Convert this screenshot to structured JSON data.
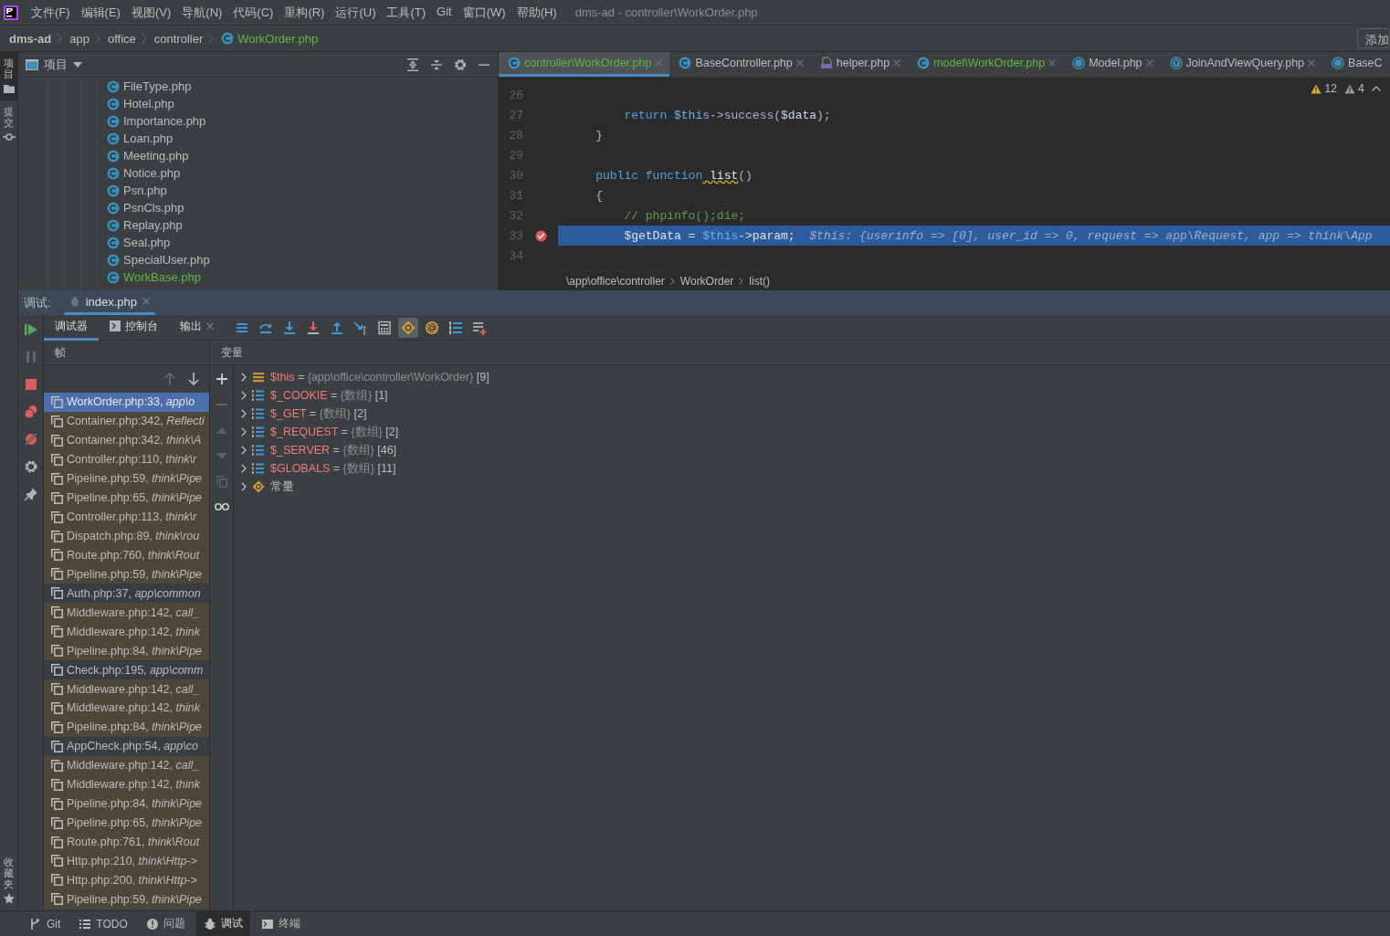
{
  "window": {
    "title": "dms-ad - controller\\WorkOrder.php"
  },
  "menu": [
    "文件(F)",
    "编辑(E)",
    "视图(V)",
    "导航(N)",
    "代码(C)",
    "重构(R)",
    "运行(U)",
    "工具(T)",
    "Git",
    "窗口(W)",
    "帮助(H)"
  ],
  "navbar": {
    "crumbs": [
      {
        "label": "dms-ad",
        "kind": "project"
      },
      {
        "label": "app",
        "kind": "dir"
      },
      {
        "label": "office",
        "kind": "dir"
      },
      {
        "label": "controller",
        "kind": "dir"
      },
      {
        "label": "WorkOrder.php",
        "kind": "file"
      }
    ],
    "button": "添加"
  },
  "side_strip": {
    "top": [
      {
        "label": "项目",
        "kind": "folder",
        "selected": true
      },
      {
        "label": "提交",
        "kind": "commit",
        "selected": false
      }
    ],
    "bottom": [
      {
        "label": "收藏夹",
        "kind": "star",
        "selected": false
      }
    ]
  },
  "project": {
    "title": "项目",
    "files": [
      {
        "name": "FileType.php",
        "modified": false
      },
      {
        "name": "Hotel.php",
        "modified": false
      },
      {
        "name": "Importance.php",
        "modified": false
      },
      {
        "name": "Loan.php",
        "modified": false
      },
      {
        "name": "Meeting.php",
        "modified": false
      },
      {
        "name": "Notice.php",
        "modified": false
      },
      {
        "name": "Psn.php",
        "modified": false
      },
      {
        "name": "PsnCls.php",
        "modified": false
      },
      {
        "name": "Replay.php",
        "modified": false
      },
      {
        "name": "Seal.php",
        "modified": false
      },
      {
        "name": "SpecialUser.php",
        "modified": false
      },
      {
        "name": "WorkBase.php",
        "modified": true
      }
    ]
  },
  "editor": {
    "tabs": [
      {
        "label": "controller\\WorkOrder.php",
        "kind": "class",
        "modified": true,
        "selected": true
      },
      {
        "label": "BaseController.php",
        "kind": "class",
        "modified": false,
        "selected": false
      },
      {
        "label": "helper.php",
        "kind": "php",
        "modified": false,
        "selected": false
      },
      {
        "label": "model\\WorkOrder.php",
        "kind": "class",
        "modified": true,
        "selected": false
      },
      {
        "label": "Model.php",
        "kind": "abstract",
        "modified": false,
        "selected": false
      },
      {
        "label": "JoinAndViewQuery.php",
        "kind": "trait",
        "modified": false,
        "selected": false
      },
      {
        "label": "BaseC",
        "kind": "abstract",
        "modified": false,
        "selected": false
      }
    ],
    "warnings": "12",
    "weak_warnings": "4",
    "lines": [
      {
        "number": "26",
        "breakpoint": false,
        "current": false
      },
      {
        "number": "27",
        "breakpoint": false,
        "current": false,
        "tokens": [
          {
            "kind": "keyword",
            "text": "        return"
          },
          {
            "kind": "this",
            "text": " $this"
          },
          {
            "kind": "plain",
            "text": "->success("
          },
          {
            "kind": "var",
            "text": "$data"
          },
          {
            "kind": "plain",
            "text": ");"
          }
        ]
      },
      {
        "number": "28",
        "breakpoint": false,
        "current": false,
        "tokens": [
          {
            "kind": "plain",
            "text": "    }"
          }
        ]
      },
      {
        "number": "29",
        "breakpoint": false,
        "current": false
      },
      {
        "number": "30",
        "breakpoint": false,
        "current": false,
        "tokens": [
          {
            "kind": "keyword",
            "text": "    public function"
          },
          {
            "kind": "warn",
            "text": " list"
          },
          {
            "kind": "plain",
            "text": "()"
          }
        ]
      },
      {
        "number": "31",
        "breakpoint": false,
        "current": false,
        "tokens": [
          {
            "kind": "plain",
            "text": "    {"
          }
        ]
      },
      {
        "number": "32",
        "breakpoint": false,
        "current": false,
        "tokens": [
          {
            "kind": "comment",
            "text": "        // phpinfo();die;"
          }
        ]
      },
      {
        "number": "33",
        "breakpoint": true,
        "current": true,
        "tokens": [
          {
            "kind": "plain",
            "text": "        $getData = "
          },
          {
            "kind": "this",
            "text": "$this"
          },
          {
            "kind": "plain",
            "text": "->param;"
          },
          {
            "kind": "hint",
            "text": "  $this: {userinfo => [0], user_id => 0, request => app\\Request, app => think\\App"
          }
        ]
      },
      {
        "number": "34",
        "breakpoint": false,
        "current": false
      }
    ],
    "breadcrumb": [
      "\\app\\office\\controller",
      "WorkOrder",
      "list()"
    ]
  },
  "debug": {
    "label": "调试:",
    "sessions": [
      {
        "label": "index.php",
        "selected": true
      }
    ],
    "side_tools": [
      {
        "kind": "resume",
        "disabled": false
      },
      {
        "kind": "pause",
        "disabled": true
      },
      {
        "kind": "stop",
        "disabled": false
      },
      {
        "kind": "breakpoints",
        "disabled": false
      },
      {
        "kind": "mute",
        "disabled": false
      },
      {
        "kind": "settings",
        "disabled": false
      },
      {
        "kind": "pin",
        "disabled": false
      }
    ],
    "tabs": [
      {
        "label": "调试器",
        "kind": "plain",
        "closable": false,
        "selected": true
      },
      {
        "label": "控制台",
        "kind": "console",
        "closable": false,
        "selected": false
      },
      {
        "label": "输出",
        "kind": "plain",
        "closable": true,
        "selected": false
      }
    ],
    "toolbar": [
      {
        "kind": "lines",
        "pressed": false
      },
      {
        "kind": "step-over",
        "pressed": false
      },
      {
        "kind": "step-into",
        "pressed": false
      },
      {
        "kind": "force-step-into",
        "pressed": false
      },
      {
        "kind": "step-out",
        "pressed": false
      },
      {
        "kind": "run-to-cursor",
        "pressed": false
      },
      {
        "kind": "evaluate",
        "pressed": false
      },
      {
        "kind": "constants",
        "pressed": true
      },
      {
        "kind": "at",
        "pressed": false
      },
      {
        "kind": "numbered",
        "pressed": false
      },
      {
        "kind": "add-list",
        "pressed": false
      }
    ],
    "frames_title": "帧",
    "frame_nav": [
      {
        "kind": "up",
        "disabled": true
      },
      {
        "kind": "down",
        "disabled": false
      }
    ],
    "frames": [
      {
        "label": "WorkOrder.php:33, *app\\o*",
        "library": false,
        "selected": true
      },
      {
        "label": "Container.php:342, *Reflecti*",
        "library": true,
        "selected": false
      },
      {
        "label": "Container.php:342, *think\\A*",
        "library": true,
        "selected": false
      },
      {
        "label": "Controller.php:110, *think\\r*",
        "library": true,
        "selected": false
      },
      {
        "label": "Pipeline.php:59, *think\\Pipe*",
        "library": true,
        "selected": false
      },
      {
        "label": "Pipeline.php:65, *think\\Pipe*",
        "library": true,
        "selected": false
      },
      {
        "label": "Controller.php:113, *think\\r*",
        "library": true,
        "selected": false
      },
      {
        "label": "Dispatch.php:89, *think\\rou*",
        "library": true,
        "selected": false
      },
      {
        "label": "Route.php:760, *think\\Rout*",
        "library": true,
        "selected": false
      },
      {
        "label": "Pipeline.php:59, *think\\Pipe*",
        "library": true,
        "selected": false
      },
      {
        "label": "Auth.php:37, *app\\common*",
        "library": false,
        "selected": false
      },
      {
        "label": "Middleware.php:142, *call_*",
        "library": true,
        "selected": false
      },
      {
        "label": "Middleware.php:142, *think*",
        "library": true,
        "selected": false
      },
      {
        "label": "Pipeline.php:84, *think\\Pipe*",
        "library": true,
        "selected": false
      },
      {
        "label": "Check.php:195, *app\\comm*",
        "library": false,
        "selected": false
      },
      {
        "label": "Middleware.php:142, *call_*",
        "library": true,
        "selected": false
      },
      {
        "label": "Middleware.php:142, *think*",
        "library": true,
        "selected": false
      },
      {
        "label": "Pipeline.php:84, *think\\Pipe*",
        "library": true,
        "selected": false
      },
      {
        "label": "AppCheck.php:54, *app\\co*",
        "library": false,
        "selected": false
      },
      {
        "label": "Middleware.php:142, *call_*",
        "library": true,
        "selected": false
      },
      {
        "label": "Middleware.php:142, *think*",
        "library": true,
        "selected": false
      },
      {
        "label": "Pipeline.php:84, *think\\Pipe*",
        "library": true,
        "selected": false
      },
      {
        "label": "Pipeline.php:65, *think\\Pipe*",
        "library": true,
        "selected": false
      },
      {
        "label": "Route.php:761, *think\\Rout*",
        "library": true,
        "selected": false
      },
      {
        "label": "Http.php:210, *think\\Http->*",
        "library": true,
        "selected": false
      },
      {
        "label": "Http.php:200, *think\\Http->*",
        "library": true,
        "selected": false
      },
      {
        "label": "Pipeline.php:59, *think\\Pipe*",
        "library": true,
        "selected": false
      }
    ],
    "variables_title": "变量",
    "var_tools": [
      {
        "kind": "add",
        "disabled": false
      },
      {
        "kind": "remove",
        "disabled": true
      },
      {
        "kind": "up",
        "disabled": true
      },
      {
        "kind": "down",
        "disabled": true
      },
      {
        "kind": "copy",
        "disabled": true
      },
      {
        "kind": "glasses",
        "disabled": false
      }
    ],
    "variables": [
      {
        "kind": "object",
        "name": "$this",
        "operator": "=",
        "value": "{app\\office\\controller\\WorkOrder}",
        "count": "[9]"
      },
      {
        "kind": "array",
        "name": "$_COOKIE",
        "operator": "=",
        "value": "{数组}",
        "count": "[1]"
      },
      {
        "kind": "array",
        "name": "$_GET",
        "operator": "=",
        "value": "{数组}",
        "count": "[2]"
      },
      {
        "kind": "array",
        "name": "$_REQUEST",
        "operator": "=",
        "value": "{数组}",
        "count": "[2]"
      },
      {
        "kind": "array",
        "name": "$_SERVER",
        "operator": "=",
        "value": "{数组}",
        "count": "[46]"
      },
      {
        "kind": "array",
        "name": "$GLOBALS",
        "operator": "=",
        "value": "{数组}",
        "count": "[11]"
      },
      {
        "kind": "constants",
        "name": "常量"
      }
    ]
  },
  "status_bar": {
    "tools": [
      {
        "label": "Git",
        "kind": "git",
        "selected": false
      },
      {
        "label": "TODO",
        "kind": "list",
        "selected": false
      },
      {
        "label": "问题",
        "kind": "alert",
        "selected": false
      },
      {
        "label": "调试",
        "kind": "bug",
        "selected": true
      },
      {
        "label": "终端",
        "kind": "terminal",
        "selected": false
      }
    ]
  }
}
